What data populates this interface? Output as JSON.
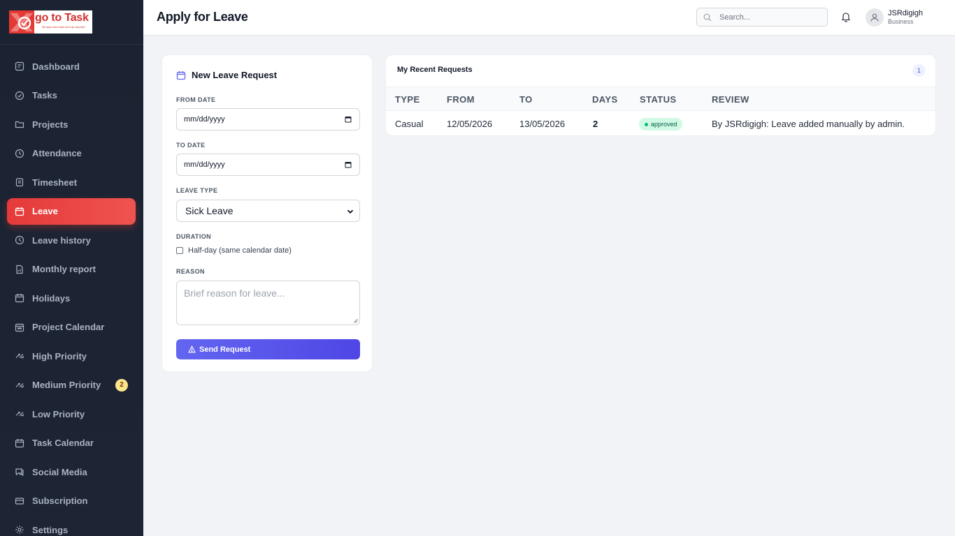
{
  "brand": {
    "name": "go to Task",
    "tagline": "We apps some tasks are truly important"
  },
  "sidebar": {
    "items": [
      {
        "label": "Dashboard",
        "icon": "dashboard-icon"
      },
      {
        "label": "Tasks",
        "icon": "check-circle-icon"
      },
      {
        "label": "Projects",
        "icon": "folder-icon"
      },
      {
        "label": "Attendance",
        "icon": "clock-icon"
      },
      {
        "label": "Timesheet",
        "icon": "clipboard-icon"
      },
      {
        "label": "Leave",
        "icon": "calendar-icon",
        "active": true
      },
      {
        "label": "Leave history",
        "icon": "clock-icon"
      },
      {
        "label": "Monthly report",
        "icon": "report-icon"
      },
      {
        "label": "Holidays",
        "icon": "calendar-icon"
      },
      {
        "label": "Project Calendar",
        "icon": "calendar-grid-icon"
      },
      {
        "label": "High Priority",
        "icon": "arrows-icon"
      },
      {
        "label": "Medium Priority",
        "icon": "arrows-icon",
        "badge": "2"
      },
      {
        "label": "Low Priority",
        "icon": "arrows-icon"
      },
      {
        "label": "Task Calendar",
        "icon": "calendar-icon"
      },
      {
        "label": "Social Media",
        "icon": "chat-icon"
      },
      {
        "label": "Subscription",
        "icon": "card-icon"
      },
      {
        "label": "Settings",
        "icon": "gear-icon"
      }
    ]
  },
  "header": {
    "title": "Apply for Leave",
    "search_placeholder": "Search...",
    "user_name": "JSRdigigh",
    "user_role": "Business"
  },
  "form": {
    "title": "New Leave Request",
    "from_date_label": "FROM DATE",
    "from_date_value": "mm/dd/yyyy",
    "to_date_label": "TO DATE",
    "to_date_value": "mm/dd/yyyy",
    "leave_type_label": "LEAVE TYPE",
    "leave_type_value": "Sick Leave",
    "duration_label": "DURATION",
    "half_day_label": "Half-day (same calendar date)",
    "reason_label": "REASON",
    "reason_placeholder": "Brief reason for leave...",
    "submit_label": "Send Request"
  },
  "requests": {
    "title": "My Recent Requests",
    "count": "1",
    "columns": [
      "TYPE",
      "FROM",
      "TO",
      "DAYS",
      "STATUS",
      "REVIEW"
    ],
    "rows": [
      {
        "type": "Casual",
        "from": "12/05/2026",
        "to": "13/05/2026",
        "days": "2",
        "status": "approved",
        "review": "By JSRdigigh: Leave added manually by admin."
      }
    ]
  },
  "colors": {
    "accent": "#e53935",
    "primary": "#4f46e5",
    "sidebar_bg": "#1b2332",
    "status_approved": "#10b981"
  }
}
